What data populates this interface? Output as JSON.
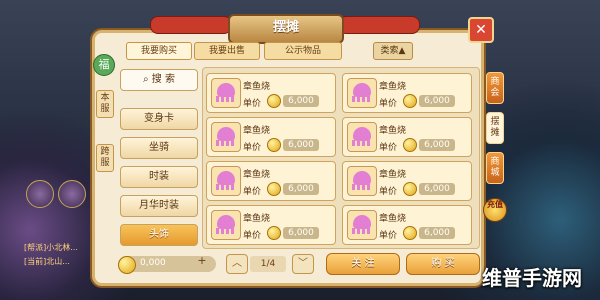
{
  "header": {
    "title": "摆摊"
  },
  "top_tabs": [
    "我要购买",
    "我要出售",
    "公示物品"
  ],
  "filter_label": "类索▲",
  "left_vtabs": [
    "本服",
    "跨服"
  ],
  "gift_label": "福",
  "categories": [
    "搜 索",
    "变身卡",
    "坐骑",
    "时装",
    "月华时装",
    "头饰"
  ],
  "items": [
    {
      "name": "章鱼烧",
      "price_label": "单价",
      "price": "6,000"
    },
    {
      "name": "章鱼烧",
      "price_label": "单价",
      "price": "6,000"
    },
    {
      "name": "章鱼烧",
      "price_label": "单价",
      "price": "6,000"
    },
    {
      "name": "章鱼烧",
      "price_label": "单价",
      "price": "6,000"
    },
    {
      "name": "章鱼烧",
      "price_label": "单价",
      "price": "6,000"
    },
    {
      "name": "章鱼烧",
      "price_label": "单价",
      "price": "6,000"
    },
    {
      "name": "章鱼烧",
      "price_label": "单价",
      "price": "6,000"
    },
    {
      "name": "章鱼烧",
      "price_label": "单价",
      "price": "6,000"
    }
  ],
  "right_tabs": [
    "商会",
    "摆摊",
    "商城"
  ],
  "recharge_label": "充值",
  "bottom": {
    "coins": "0,000",
    "page": "1/4",
    "btn_1": "关 注",
    "btn_2": "购 买"
  },
  "scene": {
    "chat_lines": [
      "[帮派]小北林...",
      "[当前]北山..."
    ],
    "bottom_badge": "贸"
  },
  "watermark": "维普手游网",
  "colors": {
    "accent": "#e59a2e",
    "panel_bg": "#f6ecd6",
    "item_icon": "#e27fd3"
  }
}
